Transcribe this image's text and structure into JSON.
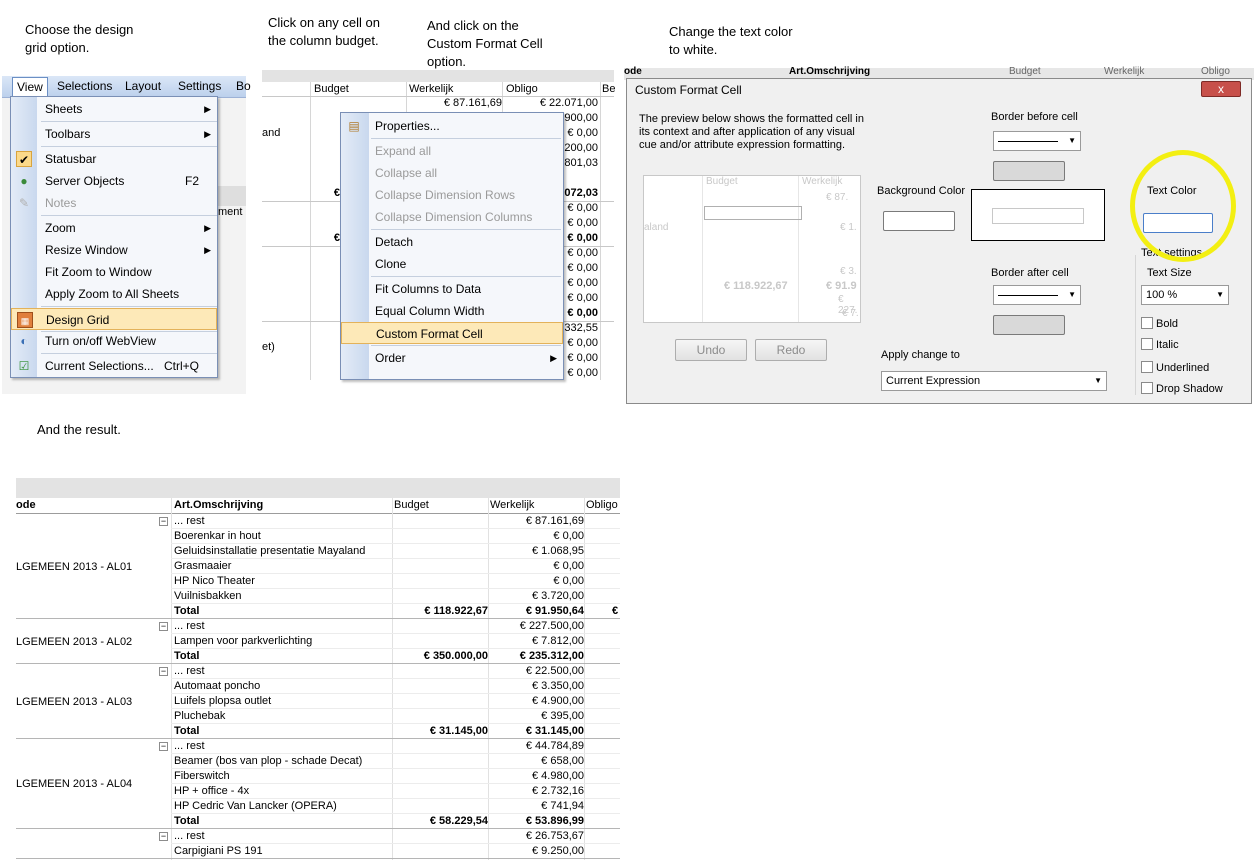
{
  "captions": {
    "step1": "Choose the design\ngrid option.",
    "step2": "Click on any cell on\nthe column budget.",
    "step3": "And click on the\nCustom Format Cell\noption.",
    "step4": "Change the text color\nto white.",
    "result": "And the result."
  },
  "view_menu": {
    "menubar": [
      "View",
      "Selections",
      "Layout",
      "Settings",
      "Bo"
    ],
    "items": [
      {
        "label": "Sheets",
        "submenu": true
      },
      {
        "label": "Toolbars",
        "submenu": true
      },
      {
        "label": "Statusbar",
        "checked": true
      },
      {
        "label": "Server Objects",
        "shortcut": "F2"
      },
      {
        "label": "Notes",
        "disabled": true
      },
      {
        "label": "Zoom",
        "submenu": true
      },
      {
        "label": "Resize Window",
        "submenu": true
      },
      {
        "label": "Fit Zoom to Window"
      },
      {
        "label": "Apply Zoom to All Sheets"
      },
      {
        "label": "Design Grid",
        "highlighted": true
      },
      {
        "label": "Turn on/off WebView"
      },
      {
        "label": "Current Selections...",
        "shortcut": "Ctrl+Q"
      }
    ],
    "background_fragments": [
      "and",
      "ment",
      "t)"
    ]
  },
  "context_menu": {
    "columns": [
      "Budget",
      "Werkelijk",
      "Obligo",
      "Be"
    ],
    "row1": {
      "werkelijk": "€ 87.161,69",
      "obligo": "€ 22.071,00"
    },
    "obligo_fragments": [
      "900,00",
      "€ 0,00",
      "200,00",
      "801,03",
      "072,03",
      "€ 0,00",
      "€ 0,00",
      "€ 0,00",
      "€ 0,00",
      "€ 0,00",
      "€ 0,00",
      "€ 0,00",
      "€ 0,00",
      "332,55",
      "€ 0,00",
      "€ 0,00",
      "€ 0,00"
    ],
    "left_fragments": [
      "and",
      "€",
      "€",
      "et)"
    ],
    "items": [
      {
        "label": "Properties..."
      },
      {
        "label": "Expand all",
        "disabled": true
      },
      {
        "label": "Collapse all",
        "disabled": true
      },
      {
        "label": "Collapse Dimension Rows",
        "disabled": true
      },
      {
        "label": "Collapse Dimension Columns",
        "disabled": true
      },
      {
        "label": "Detach"
      },
      {
        "label": "Clone"
      },
      {
        "label": "Fit Columns to Data"
      },
      {
        "label": "Equal Column Width"
      },
      {
        "label": "Custom Format Cell",
        "highlighted": true
      },
      {
        "label": "Order",
        "submenu": true
      }
    ]
  },
  "format_dialog": {
    "title": "Custom Format Cell",
    "close": "x",
    "background_header": [
      "ode",
      "Art.Omschrijving",
      "Budget",
      "Werkelijk",
      "Obligo"
    ],
    "description": "The preview below shows the formatted cell in its context and after application of any visual cue and/or attribute expression formatting.",
    "preview": {
      "budget": "Budget",
      "werkelijk": "Werkelijk",
      "row_label": "aland",
      "total": "€ 118.922,67",
      "total2": "€ 91.9",
      "v1": "€ 87.",
      "v2": "€ 1.",
      "v3": "€ 3.",
      "v4": "€ 227.",
      "v5": "€ 7."
    },
    "undo": "Undo",
    "redo": "Redo",
    "border_before": "Border before cell",
    "border_after": "Border after cell",
    "background_color": "Background Color",
    "text_color": "Text Color",
    "text_settings": "Text settings",
    "text_size_label": "Text Size",
    "text_size_value": "100 %",
    "checkboxes": [
      "Bold",
      "Italic",
      "Underlined",
      "Drop Shadow"
    ],
    "apply_change_to": "Apply change to",
    "apply_value": "Current Expression",
    "highlight_color": "#f3ef12"
  },
  "result_table": {
    "headers": {
      "code": "ode",
      "desc": "Art.Omschrijving",
      "budget": "Budget",
      "werkelijk": "Werkelijk",
      "obligo": "Obligo"
    },
    "groups": [
      {
        "name": "LGEMEEN 2013 - AL01",
        "rows": [
          {
            "label": "... rest",
            "werkelijk": "€ 87.161,69",
            "collapse": true
          },
          {
            "label": "Boerenkar in hout",
            "werkelijk": "€ 0,00"
          },
          {
            "label": "Geluidsinstallatie presentatie Mayaland",
            "werkelijk": "€ 1.068,95"
          },
          {
            "label": "Grasmaaier",
            "werkelijk": "€ 0,00"
          },
          {
            "label": "HP Nico Theater",
            "werkelijk": "€ 0,00"
          },
          {
            "label": "Vuilnisbakken",
            "werkelijk": "€ 3.720,00"
          },
          {
            "label": "Total",
            "budget": "€ 118.922,67",
            "werkelijk": "€ 91.950,64",
            "obligo": "€",
            "total": true
          }
        ]
      },
      {
        "name": "LGEMEEN 2013 - AL02",
        "rows": [
          {
            "label": "... rest",
            "werkelijk": "€ 227.500,00",
            "collapse": true
          },
          {
            "label": "Lampen voor parkverlichting",
            "werkelijk": "€ 7.812,00"
          },
          {
            "label": "Total",
            "budget": "€ 350.000,00",
            "werkelijk": "€ 235.312,00",
            "total": true
          }
        ]
      },
      {
        "name": "LGEMEEN 2013 - AL03",
        "rows": [
          {
            "label": "... rest",
            "werkelijk": "€ 22.500,00",
            "collapse": true
          },
          {
            "label": "Automaat poncho",
            "werkelijk": "€ 3.350,00"
          },
          {
            "label": "Luifels plopsa outlet",
            "werkelijk": "€ 4.900,00"
          },
          {
            "label": "Pluchebak",
            "werkelijk": "€ 395,00"
          },
          {
            "label": "Total",
            "budget": "€ 31.145,00",
            "werkelijk": "€ 31.145,00",
            "total": true
          }
        ]
      },
      {
        "name": "LGEMEEN 2013 - AL04",
        "rows": [
          {
            "label": "... rest",
            "werkelijk": "€ 44.784,89",
            "collapse": true
          },
          {
            "label": "Beamer (bos van plop - schade Decat)",
            "werkelijk": "€ 658,00"
          },
          {
            "label": "Fiberswitch",
            "werkelijk": "€ 4.980,00"
          },
          {
            "label": "HP + office - 4x",
            "werkelijk": "€ 2.732,16"
          },
          {
            "label": "HP Cedric Van Lancker (OPERA)",
            "werkelijk": "€ 741,94"
          },
          {
            "label": "Total",
            "budget": "€ 58.229,54",
            "werkelijk": "€ 53.896,99",
            "total": true
          }
        ]
      },
      {
        "name": "",
        "rows": [
          {
            "label": "... rest",
            "werkelijk": "€ 26.753,67",
            "collapse": true
          },
          {
            "label": "Carpigiani PS 191",
            "werkelijk": "€ 9.250,00"
          }
        ]
      }
    ]
  }
}
